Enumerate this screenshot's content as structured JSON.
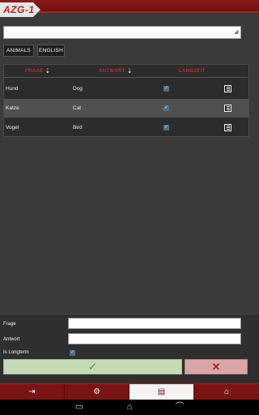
{
  "app": {
    "logo_text": "AZG-1"
  },
  "search": {
    "value": "",
    "placeholder": ""
  },
  "chips": [
    {
      "label": "ANIMALS"
    },
    {
      "label": "ENGLISH"
    }
  ],
  "table": {
    "columns": [
      {
        "label": "FRAGE",
        "sort_icon": "sort-down-icon"
      },
      {
        "label": "ANTWORT",
        "sort_icon": "sort-down-icon"
      },
      {
        "label": "LANGZEIT"
      }
    ],
    "rows": [
      {
        "frage": "Hund",
        "antwort": "Dog",
        "langzeit": true,
        "highlighted": false
      },
      {
        "frage": "Katze",
        "antwort": "Cat",
        "langzeit": true,
        "highlighted": true
      },
      {
        "frage": "Vogel",
        "antwort": "Bird",
        "langzeit": true,
        "highlighted": false
      }
    ]
  },
  "form": {
    "frage_label": "Frage",
    "frage_value": "",
    "antwort_label": "Antwort",
    "antwort_value": "",
    "longterm_label": "Is Longterm",
    "longterm_checked": true,
    "ok_icon": "checkmark-icon",
    "cancel_icon": "close-icon"
  },
  "tabs": [
    {
      "icon": "logout-icon",
      "active": false
    },
    {
      "icon": "gear-icon",
      "active": false
    },
    {
      "icon": "list-icon",
      "active": true
    },
    {
      "icon": "home-icon",
      "active": false
    }
  ],
  "system_nav": [
    {
      "icon": "recent-apps-icon"
    },
    {
      "icon": "home-chevron-icon"
    },
    {
      "icon": "back-icon"
    }
  ],
  "colors": {
    "brand_red": "#7a1313",
    "header_text_red": "#b23030",
    "ok_green": "#c4dcb6",
    "cancel_red": "#d9a6a6"
  }
}
